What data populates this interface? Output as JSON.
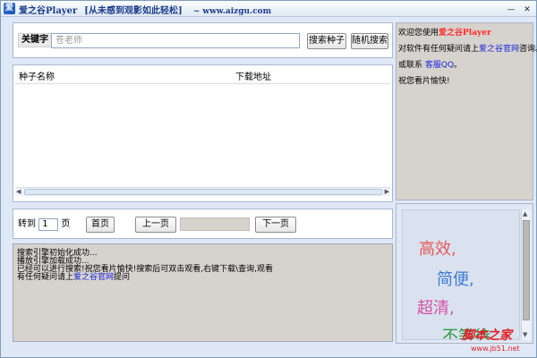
{
  "window": {
    "title": "爱之谷Player",
    "subtitle": "[从未感到观影如此轻松]",
    "url": "~ www.aizgu.com"
  },
  "search": {
    "keyword_label": "关键字",
    "placeholder": "苍老师",
    "search_button": "搜索种子",
    "random_button": "随机搜索"
  },
  "results": {
    "columns": [
      "种子名称",
      "下载地址"
    ]
  },
  "navigation": {
    "goto_label": "转到",
    "page_value": "1",
    "page_unit": "页",
    "first_button": "首页",
    "prev_button": "上一页",
    "next_button": "下一页"
  },
  "log": {
    "lines": [
      "搜索引擎初始化成功...",
      "播放引擎加载成功..."
    ],
    "line3": "已经可以进行搜索!祝您看片愉快!搜索后可双击观看,右键下载\\查询,观看",
    "line4_prefix": "有任何疑问请上",
    "line4_link": "爱之谷官网",
    "line4_suffix": "提问"
  },
  "info": {
    "welcome_prefix": "欢迎您使用",
    "brand": "爱之谷Player",
    "question_prefix": "对软件有任何疑问请上",
    "site_link": "爱之谷官网",
    "question_suffix": "咨询。",
    "contact_prefix": "或联系 ",
    "contact_link": "客服QQ",
    "contact_suffix": "。",
    "wish": "祝您看片愉快!"
  },
  "ad": {
    "words": [
      "高效,",
      "简便,",
      "超清,",
      "不等待"
    ],
    "colors": [
      "#e8585c",
      "#3b7ad6",
      "#d64fa8",
      "#2f9a4a"
    ]
  },
  "watermark": {
    "text": "脚本之家",
    "url": "www.jb51.net"
  }
}
